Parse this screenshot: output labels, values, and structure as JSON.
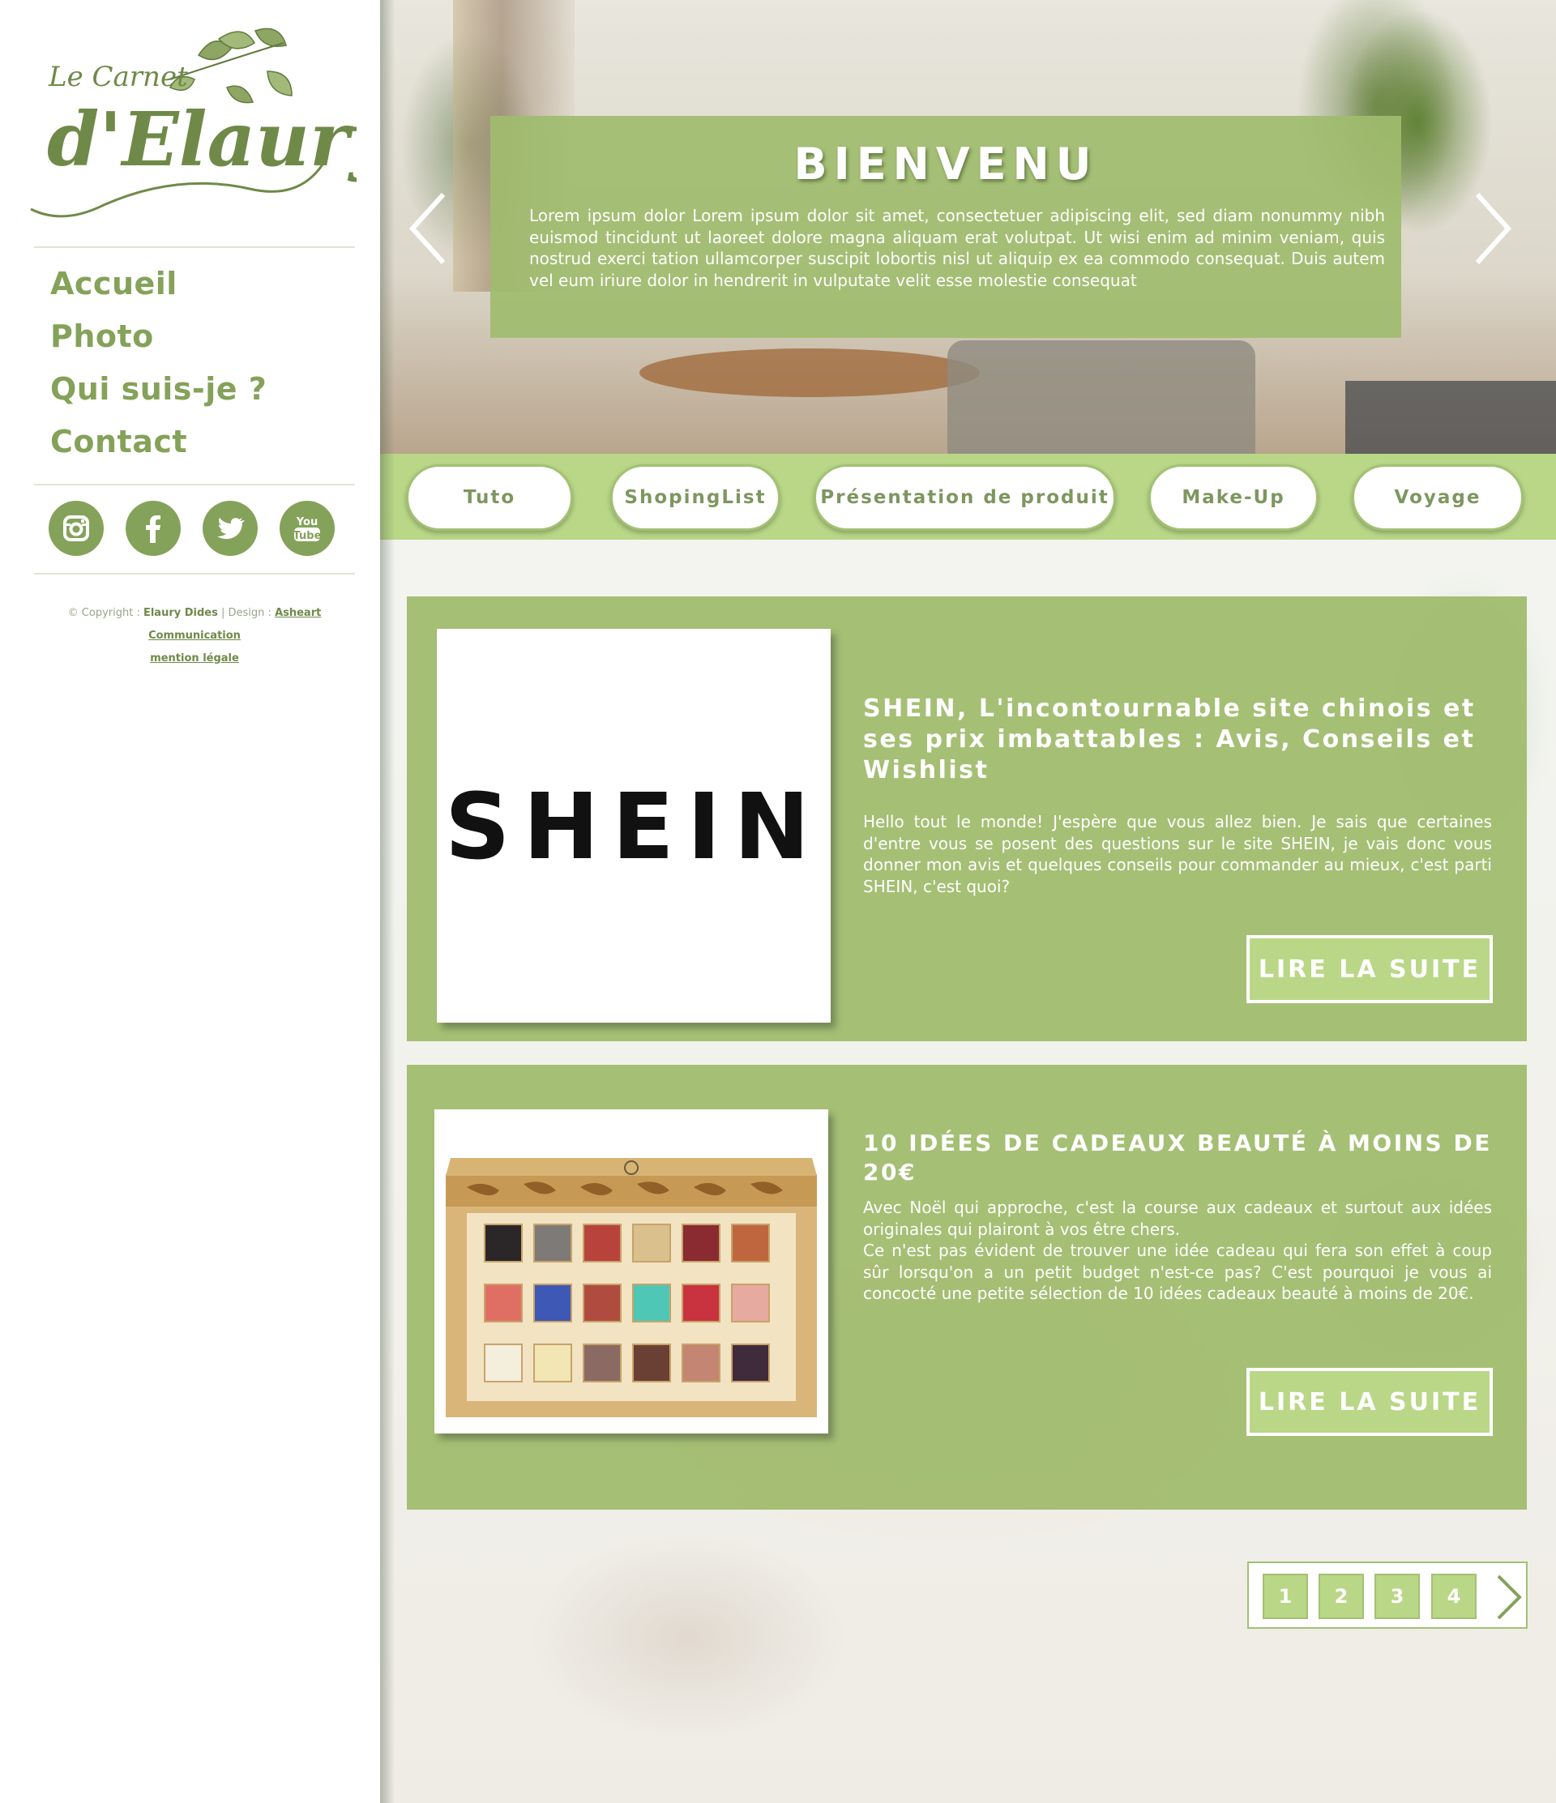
{
  "logo": {
    "line1": "Le Carnet",
    "line2": "d'Elaury"
  },
  "nav": [
    "Accueil",
    "Photo",
    "Qui suis-je ?",
    "Contact"
  ],
  "socials": [
    "instagram-icon",
    "facebook-icon",
    "twitter-icon",
    "youtube-icon"
  ],
  "youtube_label": {
    "top": "You",
    "bottom": "Tube"
  },
  "copyright": {
    "prefix": "© Copyright :",
    "author": "Elaury Dides",
    "design_label": "| Design :",
    "designer": "Asheart Communication",
    "legal": "mention légale"
  },
  "hero": {
    "title": "BIENVENU",
    "text": "Lorem ipsum dolor Lorem ipsum dolor sit amet, consectetuer adipiscing elit, sed diam nonummy nibh euismod tincidunt ut laoreet dolore magna aliquam erat volutpat. Ut wisi enim ad minim veniam, quis nostrud exerci tation ullamcorper suscipit lobortis nisl ut aliquip ex ea commodo consequat. Duis autem vel eum iriure dolor in hendrerit in vulputate velit esse molestie consequat"
  },
  "categories": [
    "Tuto",
    "ShopingList",
    "Présentation de produit",
    "Make-Up",
    "Voyage"
  ],
  "posts": [
    {
      "image_text": "SHEIN",
      "title": "SHEIN, L'incontournable site chinois et ses prix imbattables : Avis, Conseils et Wishlist",
      "text": "Hello tout le monde! J'espère que vous allez bien. Je sais que certaines d'entre vous se posent des questions sur le site SHEIN, je vais donc vous donner mon avis et quelques conseils pour commander au mieux, c'est parti SHEIN, c'est quoi?",
      "button": "LIRE LA SUITE"
    },
    {
      "title": "10 IDÉES DE CADEAUX BEAUTÉ À MOINS DE 20€",
      "text_lines": [
        "Avec Noël qui approche, c'est la course aux cadeaux et surtout aux idées originales qui plairont à vos être chers.",
        "Ce n'est pas évident de trouver une idée cadeau qui fera son effet à coup sûr lorsqu'on a un petit budget n'est-ce pas? C'est pourquoi je vous ai concocté une petite sélection de 10 idées cadeaux beauté à moins de 20€."
      ],
      "button": "LIRE LA SUITE"
    }
  ],
  "pagination": [
    "1",
    "2",
    "3",
    "4"
  ],
  "palette_colors": [
    [
      "#2b2628",
      "#7d7a78",
      "#b8433d",
      "#d9c08c",
      "#8a2a31",
      "#c0663f"
    ],
    [
      "#e06f63",
      "#3e58b5",
      "#b04b40",
      "#4ec7b6",
      "#c9323f",
      "#e6aaa0"
    ],
    [
      "#f4eedd",
      "#f2e6b5",
      "#8a6a62",
      "#6b4034",
      "#c48573",
      "#3f2b3c"
    ]
  ],
  "colors": {
    "accent": "#84a259",
    "panel": "#a0bc6e",
    "bar": "#b9d787"
  }
}
